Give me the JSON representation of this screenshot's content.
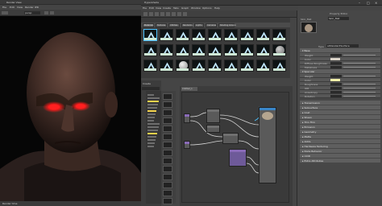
{
  "left_window": {
    "title": "Render View",
    "menus": [
      "File",
      "Edit",
      "View",
      "Render",
      "IPR",
      "Options",
      "Display",
      "Help"
    ],
    "camera_field": "persp",
    "status_text": "Render time"
  },
  "hypershade": {
    "title": "Hypershade",
    "menus": [
      "File",
      "Edit",
      "View",
      "Create",
      "Tabs",
      "Graph",
      "Window",
      "Options",
      "Help"
    ],
    "browser_tabs": [
      "Materials",
      "Textures",
      "Utilities",
      "Rendering",
      "Lights",
      "Cameras",
      "Shading Groups"
    ],
    "swatch_labels": [
      "aiStandardSurface",
      "lambert1",
      "standardSurface1",
      "particleCloud1",
      "shaderGlow1"
    ],
    "node_editor_tab": "Untitled_1",
    "create_panel_title": "Create",
    "create_list": [
      "Favorites",
      "Maya",
      "Surface",
      "Volumetric",
      "Displacement",
      "2D Textures",
      "3D Textures",
      "Env Textures",
      "Other Textures",
      "Lights",
      "Utilities",
      "Image Planes",
      "Arnold",
      "Texture",
      "Light",
      "Shader",
      "Utility"
    ]
  },
  "property_editor": {
    "title": "Property Editor",
    "node_name": "Skin_Mat",
    "type_label": "Type",
    "type_value": "aiStandardSurface",
    "sections": [
      "Base",
      "Specular",
      "Transmission",
      "Subsurface",
      "Coat",
      "Sheen",
      "Thin Film",
      "Emission",
      "Geometry",
      "Matte",
      "AOVs",
      "Hardware Texturing",
      "Node Behavior",
      "UUID",
      "Extra Attributes"
    ],
    "base_fields": [
      "Weight",
      "Color",
      "Diffuse Roughness",
      "Metalness"
    ],
    "specular_fields": [
      "Weight",
      "Color",
      "Roughness",
      "IOR",
      "Anisotropy",
      "Rotation"
    ]
  },
  "colors": {
    "accent": "#4ec3ff",
    "highlight": "#f2d24b",
    "eye_glow": "#ff1a1a",
    "swatch_label_bg": "#cfe9d6"
  }
}
